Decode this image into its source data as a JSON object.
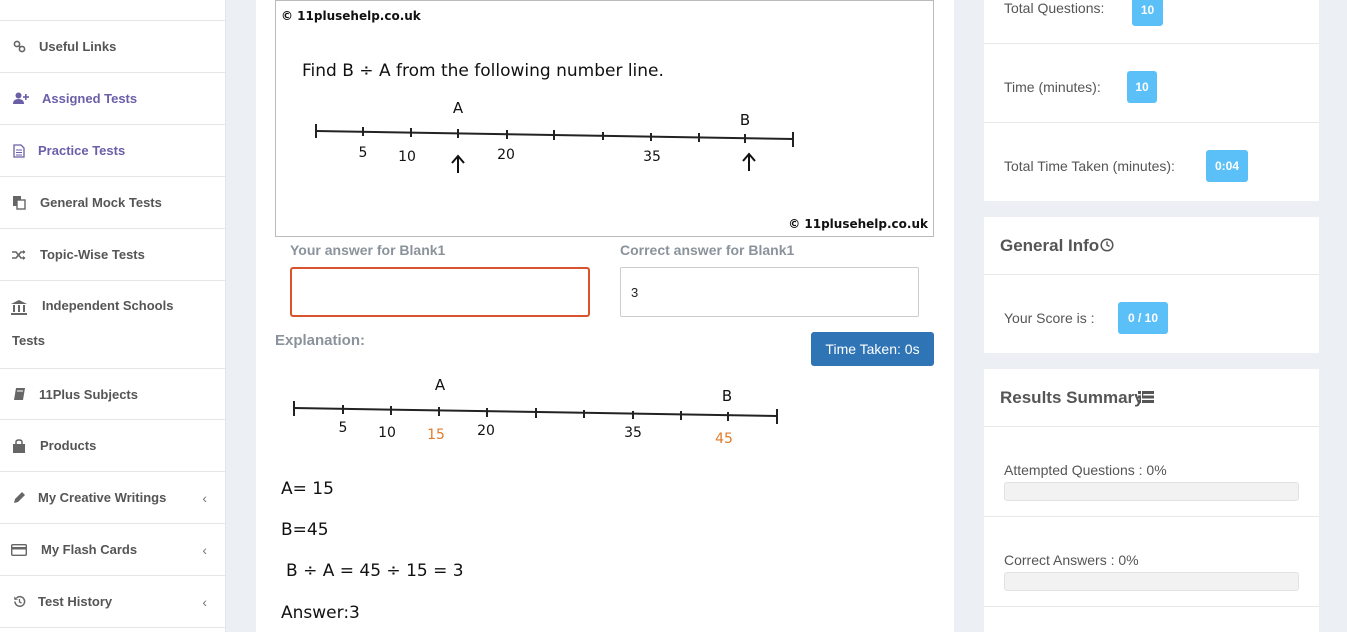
{
  "sidebar": {
    "items": [
      {
        "label": "Useful Links",
        "icon": "link-icon"
      },
      {
        "label": "Assigned Tests",
        "icon": "user-plus-icon"
      },
      {
        "label": "Practice Tests",
        "icon": "document-icon"
      },
      {
        "label": "General Mock Tests",
        "icon": "copy-icon"
      },
      {
        "label": "Topic-Wise Tests",
        "icon": "shuffle-icon"
      },
      {
        "label": "Independent Schools Tests",
        "icon": "bank-icon"
      },
      {
        "label": "11Plus Subjects",
        "icon": "book-icon"
      },
      {
        "label": "Products",
        "icon": "shopping-bag-icon"
      },
      {
        "label": "My Creative Writings",
        "icon": "pencil-icon"
      },
      {
        "label": "My Flash Cards",
        "icon": "credit-card-icon"
      },
      {
        "label": "Test History",
        "icon": "history-icon"
      }
    ],
    "isb_line1": "Independent Schools",
    "isb_line2": "Tests"
  },
  "question": {
    "copyright_top": "© 11plusehelp.co.uk",
    "copyright_bottom": "© 11plusehelp.co.uk",
    "text": "Find B ÷ A from the following number line.",
    "point_a": "A",
    "point_b": "B",
    "tick_labels": [
      "5",
      "10",
      "20",
      "35"
    ]
  },
  "answer": {
    "your_label": "Your answer for Blank1",
    "your_value": "",
    "correct_label": "Correct answer for Blank1",
    "correct_value": "3"
  },
  "explanation": {
    "label": "Explanation:",
    "time_taken": "Time Taken: 0s",
    "point_a": "A",
    "point_b": "B",
    "tick_labels": [
      "5",
      "10",
      "15",
      "20",
      "35",
      "45"
    ],
    "lines": [
      "A= 15",
      "B=45",
      "B ÷ A = 45 ÷ 15 = 3",
      "Answer:3"
    ],
    "highlight_color": "#e07b2a"
  },
  "stats": {
    "total_questions_label": "Total Questions:",
    "total_questions": "10",
    "time_label": "Time (minutes):",
    "time": "10",
    "time_taken_label": "Total Time Taken (minutes):",
    "time_taken": "0:04"
  },
  "general_info": {
    "title": "General Info",
    "score_label": "Your Score is :",
    "score": "0 / 10"
  },
  "results": {
    "title": "Results Summary",
    "attempted_label": "Attempted Questions : 0%",
    "attempted_pct": 0,
    "correct_label": "Correct Answers : 0%",
    "correct_pct": 0
  },
  "colors": {
    "badge": "#5bc0f8",
    "button": "#2f74b5",
    "error_border": "#d9532f",
    "active_nav": "#6a5fa8"
  }
}
